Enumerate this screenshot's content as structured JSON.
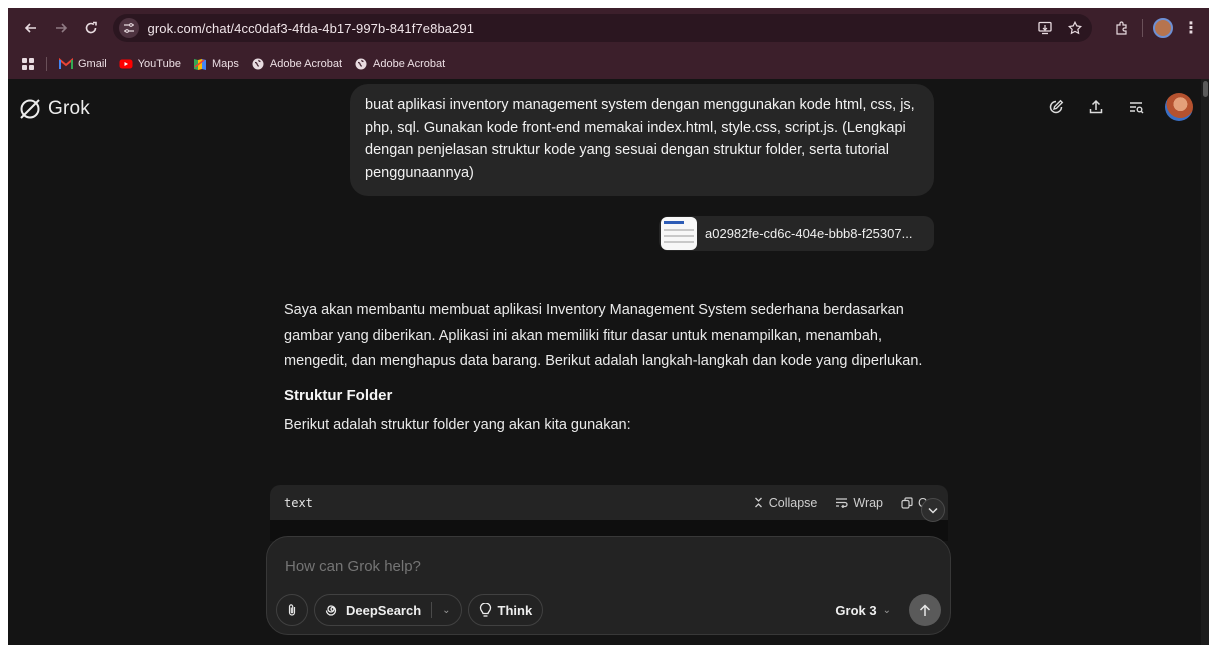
{
  "browser": {
    "url": "grok.com/chat/4cc0daf3-4fda-4b17-997b-841f7e8ba291",
    "bookmarks": [
      {
        "label": "Gmail",
        "icon": "gmail-icon"
      },
      {
        "label": "YouTube",
        "icon": "youtube-icon"
      },
      {
        "label": "Maps",
        "icon": "maps-icon"
      },
      {
        "label": "Adobe Acrobat",
        "icon": "globe-icon"
      },
      {
        "label": "Adobe Acrobat",
        "icon": "globe-icon"
      }
    ],
    "colors": {
      "frame": "#3c1f2b",
      "omnibox": "#2b1620"
    }
  },
  "app": {
    "brand": "Grok",
    "user_message": "buat aplikasi inventory management system dengan menggunakan kode html, css, js, php, sql. Gunakan kode front-end memakai index.html, style.css, script.js. (Lengkapi dengan penjelasan struktur kode yang sesuai dengan struktur folder, serta tutorial penggunaannya)",
    "attachment_name": "a02982fe-cd6c-404e-bbb8-f25307...",
    "assistant": {
      "intro": "Saya akan membantu membuat aplikasi Inventory Management System sederhana berdasarkan gambar yang diberikan. Aplikasi ini akan memiliki fitur dasar untuk menampilkan, menambah, mengedit, dan menghapus data barang. Berikut adalah langkah-langkah dan kode yang diperlukan.",
      "heading": "Struktur Folder",
      "lead": "Berikut adalah struktur folder yang akan kita gunakan:"
    },
    "code_block": {
      "language": "text",
      "collapse_label": "Collapse",
      "wrap_label": "Wrap",
      "copy_label": "Co"
    },
    "composer": {
      "placeholder": "How can Grok help?",
      "deepsearch_label": "DeepSearch",
      "think_label": "Think",
      "model_label": "Grok 3"
    },
    "colors": {
      "background": "#141414",
      "bubble": "#262626",
      "composer": "#232323"
    }
  }
}
